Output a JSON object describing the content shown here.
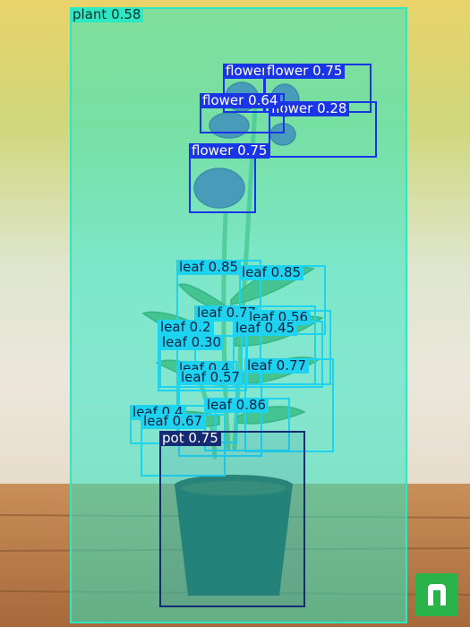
{
  "colors": {
    "plant": "#2ee8c4",
    "flower": "#1a35e6",
    "leaf": "#1ed3f0",
    "pot": "#142a72",
    "logo_bg": "#29b34a"
  },
  "logo": {
    "icon": "n-logo-icon"
  },
  "detections": [
    {
      "label": "plant",
      "score": "0.58",
      "kind": "plant"
    },
    {
      "label": "flower",
      "score": "0.75",
      "kind": "flower"
    },
    {
      "label": "flower",
      "score": "0.75",
      "kind": "flower"
    },
    {
      "label": "flower",
      "score": "0.28",
      "kind": "flower"
    },
    {
      "label": "flower",
      "score": "0.64",
      "kind": "flower"
    },
    {
      "label": "flower",
      "score": "0.75",
      "kind": "flower"
    },
    {
      "label": "leaf",
      "score": "0.85",
      "kind": "leaf"
    },
    {
      "label": "leaf",
      "score": "0.85",
      "kind": "leaf"
    },
    {
      "label": "leaf",
      "score": "0.77",
      "kind": "leaf"
    },
    {
      "label": "leaf",
      "score": "0.56",
      "kind": "leaf"
    },
    {
      "label": "leaf",
      "score": "0.2",
      "kind": "leaf"
    },
    {
      "label": "leaf",
      "score": "0.45",
      "kind": "leaf"
    },
    {
      "label": "leaf",
      "score": "0.30",
      "kind": "leaf"
    },
    {
      "label": "leaf",
      "score": "0.4",
      "kind": "leaf"
    },
    {
      "label": "leaf",
      "score": "0.77",
      "kind": "leaf"
    },
    {
      "label": "leaf",
      "score": "0.57",
      "kind": "leaf"
    },
    {
      "label": "leaf",
      "score": "0.4",
      "kind": "leaf"
    },
    {
      "label": "leaf",
      "score": "0.86",
      "kind": "leaf"
    },
    {
      "label": "leaf",
      "score": "0.67",
      "kind": "leaf"
    },
    {
      "label": "pot",
      "score": "0.75",
      "kind": "pot"
    }
  ]
}
